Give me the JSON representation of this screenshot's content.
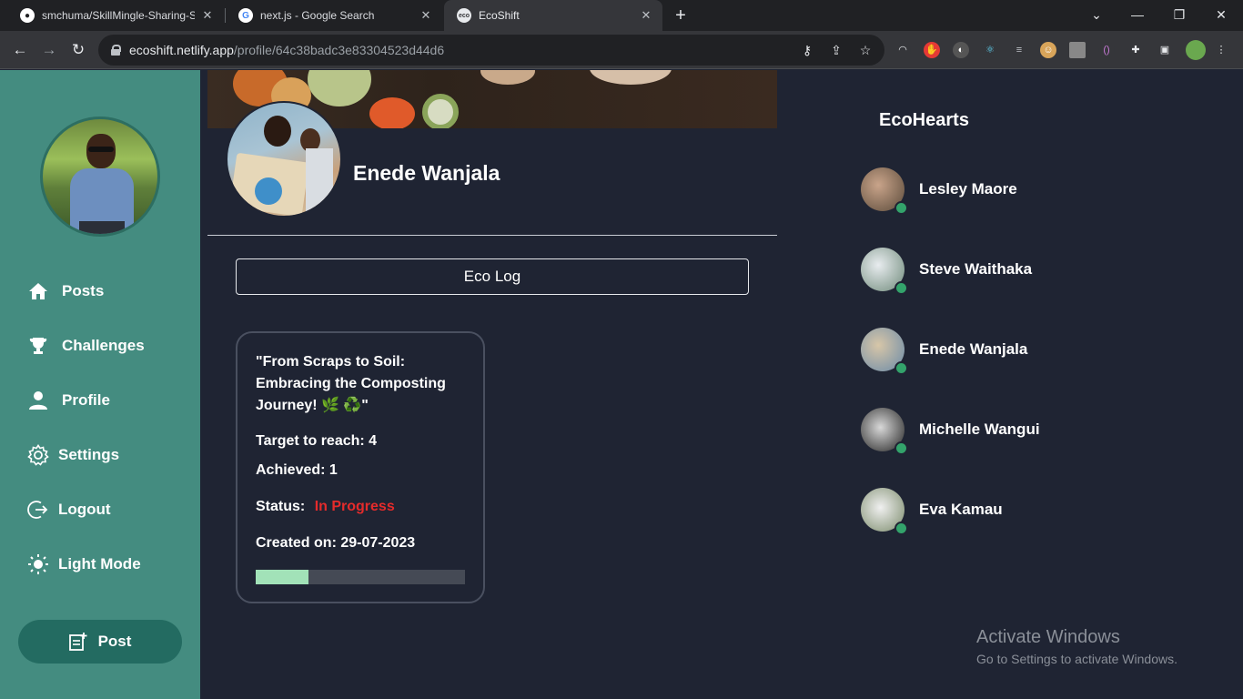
{
  "browser": {
    "tabs": [
      {
        "label": "smchuma/SkillMingle-Sharing-S",
        "favicon": "github-icon"
      },
      {
        "label": "next.js - Google Search",
        "favicon": "google-icon"
      },
      {
        "label": "EcoShift",
        "favicon": "ecoshift-icon"
      }
    ],
    "url_host": "ecoshift.netlify.app",
    "url_path": "/profile/64c38badc3e83304523d44d6"
  },
  "sidebar": {
    "nav": [
      {
        "label": "Posts",
        "icon": "home-icon"
      },
      {
        "label": "Challenges",
        "icon": "trophy-icon"
      },
      {
        "label": "Profile",
        "icon": "user-icon"
      },
      {
        "label": "Settings",
        "icon": "gear-icon"
      },
      {
        "label": "Logout",
        "icon": "logout-icon"
      },
      {
        "label": "Light Mode",
        "icon": "sun-icon"
      }
    ],
    "post_button": "Post"
  },
  "profile": {
    "name": "Enede Wanjala",
    "eco_log_button": "Eco Log"
  },
  "challenge_card": {
    "title": "\"From Scraps to Soil: Embracing the Composting Journey! 🌿 ♻️\"",
    "target": "Target to reach: 4",
    "achieved": "Achieved: 1",
    "status_label": "Status:",
    "status_value": "In Progress",
    "created": "Created on: 29-07-2023",
    "progress_fraction": 0.25
  },
  "eco_hearts": {
    "title": "EcoHearts",
    "friends": [
      {
        "name": "Lesley Maore",
        "online": true
      },
      {
        "name": "Steve Waithaka",
        "online": true
      },
      {
        "name": "Enede Wanjala",
        "online": true
      },
      {
        "name": "Michelle Wangui",
        "online": true
      },
      {
        "name": "Eva Kamau",
        "online": true
      }
    ]
  },
  "watermark": {
    "line1": "Activate Windows",
    "line2": "Go to Settings to activate Windows."
  },
  "colors": {
    "sidebar": "#448c80",
    "post_button": "#236b61",
    "background": "#1f2433",
    "status_in_progress": "#e52b2b",
    "progress_fill": "#a2e2b8",
    "online_dot": "#33a36b"
  }
}
